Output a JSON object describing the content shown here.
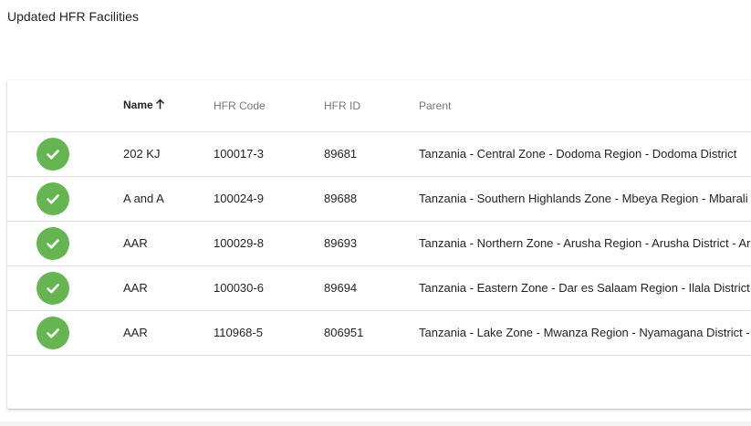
{
  "page": {
    "title": "Updated HFR Facilities"
  },
  "table": {
    "columns": {
      "name": "Name",
      "hfr_code": "HFR Code",
      "hfr_id": "HFR ID",
      "parent": "Parent"
    },
    "sort": {
      "column": "Name",
      "direction": "ascending"
    },
    "status_icon": "check-circle-icon",
    "status_color": "#67b552",
    "rows": [
      {
        "name": "202 KJ",
        "hfr_code": "100017-3",
        "hfr_id": "89681",
        "parent": "Tanzania - Central Zone - Dodoma Region - Dodoma District"
      },
      {
        "name": "A and A",
        "hfr_code": "100024-9",
        "hfr_id": "89688",
        "parent": "Tanzania - Southern Highlands Zone - Mbeya Region - Mbarali D"
      },
      {
        "name": "AAR",
        "hfr_code": "100029-8",
        "hfr_id": "89693",
        "parent": "Tanzania - Northern Zone - Arusha Region - Arusha District - Aru"
      },
      {
        "name": "AAR",
        "hfr_code": "100030-6",
        "hfr_id": "89694",
        "parent": "Tanzania - Eastern Zone - Dar es Salaam Region - Ilala District -"
      },
      {
        "name": "AAR",
        "hfr_code": "110968-5",
        "hfr_id": "806951",
        "parent": "Tanzania - Lake Zone - Mwanza Region - Nyamagana District - N"
      }
    ]
  }
}
